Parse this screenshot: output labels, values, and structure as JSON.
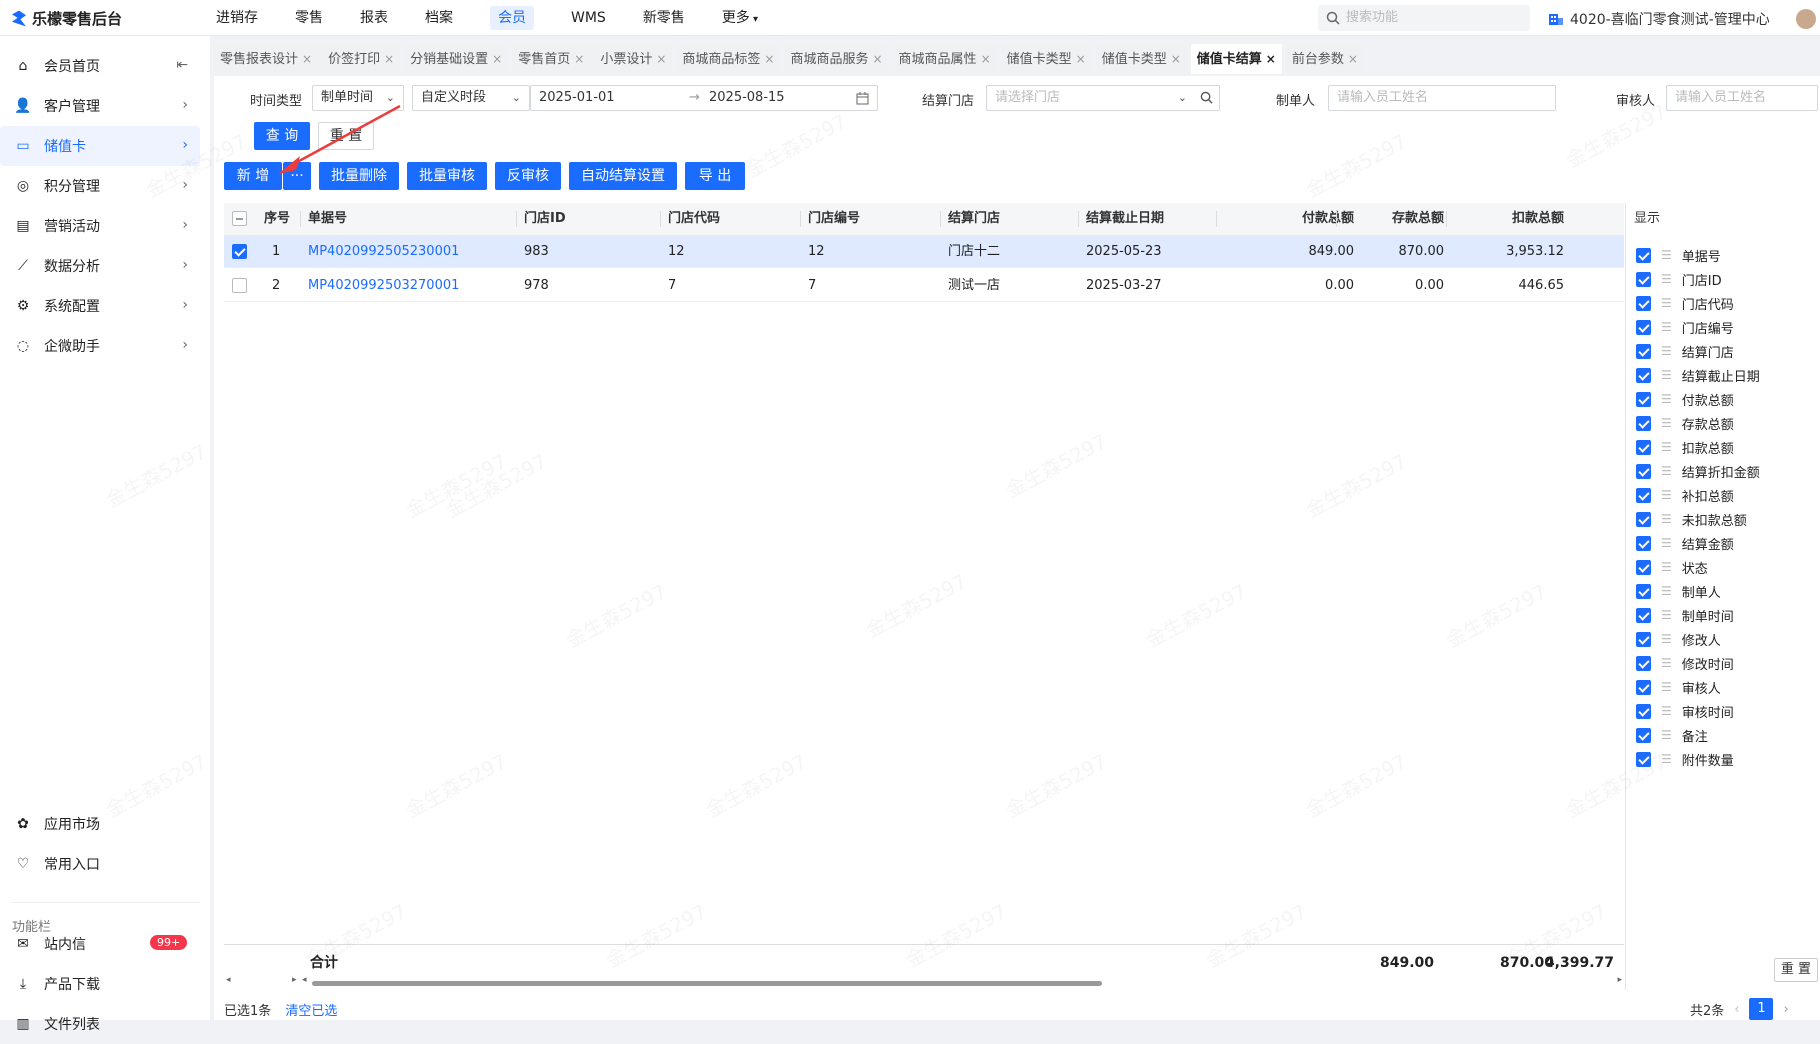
{
  "app": {
    "title": "乐檬零售后台"
  },
  "topnav": [
    "进销存",
    "零售",
    "报表",
    "档案",
    "会员",
    "WMS",
    "新零售",
    "更多"
  ],
  "topnav_active": "会员",
  "search": {
    "placeholder": "搜索功能"
  },
  "user": {
    "label": "4020-喜临门零食测试-管理中心"
  },
  "sidebar": {
    "items": [
      {
        "label": "会员首页",
        "icon": "home-icon"
      },
      {
        "label": "客户管理",
        "icon": "user-icon"
      },
      {
        "label": "储值卡",
        "icon": "card-icon"
      },
      {
        "label": "积分管理",
        "icon": "coins-icon"
      },
      {
        "label": "营销活动",
        "icon": "chart-icon"
      },
      {
        "label": "数据分析",
        "icon": "trend-icon"
      },
      {
        "label": "系统配置",
        "icon": "settings-icon"
      },
      {
        "label": "企微助手",
        "icon": "chat-icon"
      }
    ],
    "bottom": [
      {
        "label": "应用市场",
        "icon": "apps-icon"
      },
      {
        "label": "常用入口",
        "icon": "heart-icon"
      }
    ],
    "section": "功能栏",
    "tools": [
      {
        "label": "站内信",
        "icon": "mail-icon",
        "badge": "99+"
      },
      {
        "label": "产品下载",
        "icon": "download-icon"
      },
      {
        "label": "文件列表",
        "icon": "file-icon"
      }
    ]
  },
  "tabs": [
    "零售报表设计",
    "价签打印",
    "分销基础设置",
    "零售首页",
    "小票设计",
    "商城商品标签",
    "商城商品服务",
    "商城商品属性",
    "储值卡类型",
    "储值卡类型",
    "储值卡结算",
    "前台参数"
  ],
  "tabs_active_index": 10,
  "filters": {
    "time_type_label": "时间类型",
    "time_type_value": "制单时间",
    "range_value": "自定义时段",
    "date_start": "2025-01-01",
    "date_end": "2025-08-15",
    "store_label": "结算门店",
    "store_placeholder": "请选择门店",
    "maker_label": "制单人",
    "maker_placeholder": "请输入员工姓名",
    "auditor_label": "审核人",
    "auditor_placeholder": "请输入员工姓名",
    "query_btn": "查 询",
    "reset_btn": "重 置"
  },
  "toolbar": {
    "add": "新 增",
    "more": "···",
    "batch_delete": "批量删除",
    "batch_audit": "批量审核",
    "unaudit": "反审核",
    "auto_settle": "自动结算设置",
    "export": "导 出"
  },
  "table": {
    "columns": [
      "序号",
      "单据号",
      "门店ID",
      "门店代码",
      "门店编号",
      "结算门店",
      "结算截止日期",
      "付款总额",
      "存款总额",
      "扣款总额"
    ],
    "rows": [
      {
        "checked": true,
        "no": "1",
        "doc": "MP4020992505230001",
        "store_id": "983",
        "store_code": "12",
        "store_num": "12",
        "store": "门店十二",
        "date": "2025-05-23",
        "pay": "849.00",
        "deposit": "870.00",
        "deduct": "3,953.12"
      },
      {
        "checked": false,
        "no": "2",
        "doc": "MP4020992503270001",
        "store_id": "978",
        "store_code": "7",
        "store_num": "7",
        "store": "测试一店",
        "date": "2025-03-27",
        "pay": "0.00",
        "deposit": "0.00",
        "deduct": "446.65"
      }
    ],
    "total_label": "合计",
    "total_pay": "849.00",
    "total_deposit": "870.00",
    "total_deduct": "4,399.77"
  },
  "column_panel": {
    "header": "显示",
    "items": [
      "单据号",
      "门店ID",
      "门店代码",
      "门店编号",
      "结算门店",
      "结算截止日期",
      "付款总额",
      "存款总额",
      "扣款总额",
      "结算折扣金额",
      "补扣总额",
      "未扣款总额",
      "结算金额",
      "状态",
      "制单人",
      "制单时间",
      "修改人",
      "修改时间",
      "审核人",
      "审核时间",
      "备注",
      "附件数量"
    ],
    "reset": "重 置"
  },
  "footer": {
    "selected": "已选1条",
    "clear": "清空已选",
    "total": "共2条",
    "page": "1"
  },
  "watermark": "金生森5297",
  "colors": {
    "accent": "#1a6cff",
    "selected_row": "#dfe9ff",
    "badge": "#f5364b"
  }
}
